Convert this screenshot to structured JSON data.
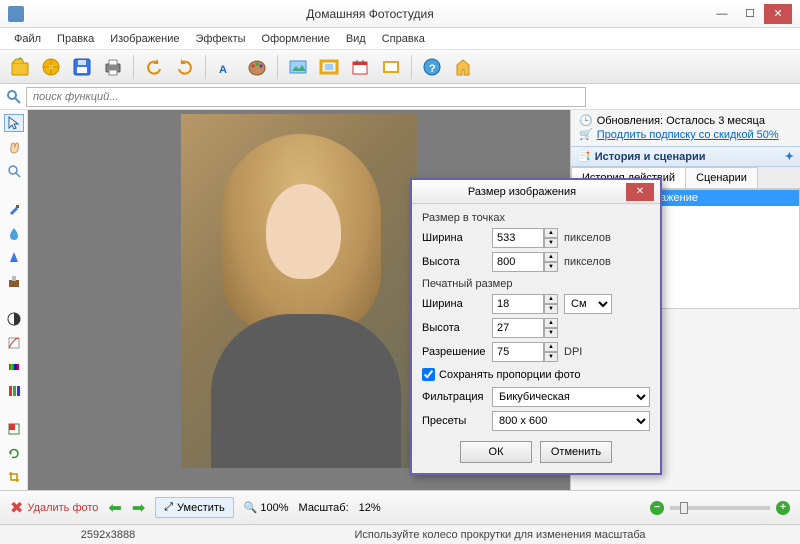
{
  "titlebar": {
    "title": "Домашняя Фотостудия"
  },
  "menu": {
    "file": "Файл",
    "edit": "Правка",
    "image": "Изображение",
    "effects": "Эффекты",
    "design": "Оформление",
    "view": "Вид",
    "help": "Справка"
  },
  "search": {
    "placeholder": "поиск функций..."
  },
  "updates": {
    "remaining": "Обновления: Осталось  3 месяца",
    "extend_link": "Продлить подписку со скидкой 50%"
  },
  "history_panel": {
    "title": "История и сценарии",
    "tab_history": "История действий",
    "tab_scen": "Сценарии",
    "item0": "Исходное изображение"
  },
  "dialog": {
    "title": "Размер изображения",
    "pixel_size": "Размер в точках",
    "width_lbl": "Ширина",
    "height_lbl": "Высота",
    "width_px": "533",
    "height_px": "800",
    "px_unit": "пикселов",
    "print_size": "Печатный размер",
    "width_cm": "18",
    "height_cm": "27",
    "unit_cm": "См",
    "resolution_lbl": "Разрешение",
    "resolution": "75",
    "dpi": "DPI",
    "keep_ratio": "Сохранять пропорции фото",
    "filter_lbl": "Фильтрация",
    "filter_val": "Бикубическая",
    "presets_lbl": "Пресеты",
    "presets_val": "800 x 600",
    "ok": "ОК",
    "cancel": "Отменить"
  },
  "bottom": {
    "delete": "Удалить фото",
    "fit": "Уместить",
    "zoom100": "100%",
    "scale_lbl": "Масштаб:",
    "scale_val": "12%"
  },
  "status": {
    "dims": "2592x3888",
    "hint": "Используйте колесо прокрутки для изменения масштаба"
  }
}
